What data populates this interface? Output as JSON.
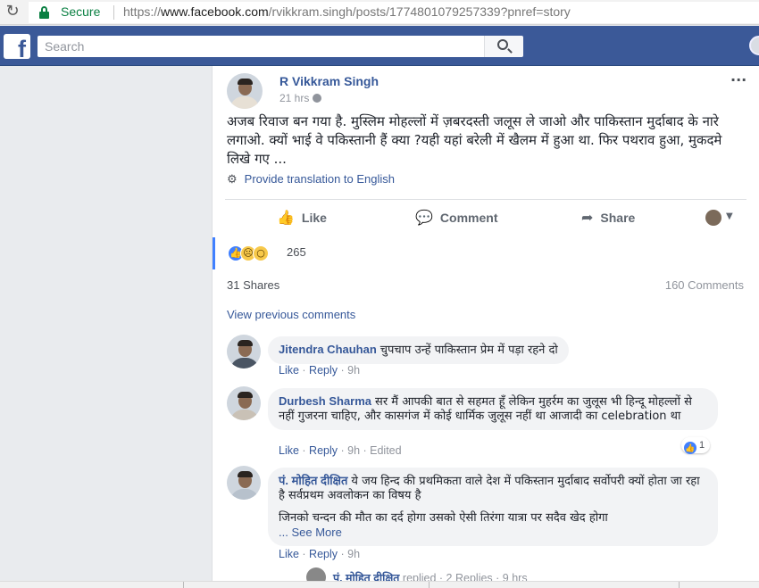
{
  "browser": {
    "security_label": "Secure",
    "url_prefix": "https://",
    "url_domain": "www.facebook.com",
    "url_path": "/rvikkram.singh/posts/1774801079257339?pnref=story"
  },
  "topbar": {
    "logo": "f",
    "search_placeholder": "Search"
  },
  "post": {
    "author": "R Vikkram Singh",
    "time": "21 hrs",
    "text": "अजब रिवाज बन गया है. मुस्लिम मोहल्लों में ज़बरदस्ती जलूस ले जाओ और पाकिस्तान मुर्दाबाद के नारे लगाओ. क्यों भाई वे पकिस्तानी हैं क्या ?यही यहां बरेली में खैलम में हुआ था. फिर पथराव हुआ, मुकदमे लिखे गए ...",
    "translate_label": "Provide translation to English",
    "actions": {
      "like": "Like",
      "comment": "Comment",
      "share": "Share"
    },
    "reaction_count": "265",
    "shares": "31 Shares",
    "comments_count": "160 Comments",
    "view_previous": "View previous comments"
  },
  "comments": [
    {
      "name": "Jitendra Chauhan",
      "text": "चुपचाप उन्हें पाकिस्तान प्रेम में पड़ा रहने दो",
      "like": "Like",
      "reply": "Reply",
      "time": "9h"
    },
    {
      "name": "Durbesh Sharma",
      "text": "सर मैं आपकी बात से सहमत हूँ लेकिन मुहर्रम का जुलूस भी हिन्दू मोहल्लों से नहीं गुजरना चाहिए, और कासगंज में कोई धार्मिक जुलूस नहीं था आजादी का celebration था",
      "like": "Like",
      "reply": "Reply",
      "time": "9h",
      "edited": "Edited",
      "like_count": "1"
    },
    {
      "name": "पं. मोहित दीक्षित",
      "text": "ये जय हिन्द की प्रथमिकता वाले देश में पकिस्तान मुर्दाबाद सर्वोपरी क्यों होता जा रहा है सर्वप्रथम अवलोकन का विषय है",
      "text2": "जिनको चन्दन की मौत का दर्द होगा उसको ऐसी तिरंगा यात्रा पर सदैव खेद होगा",
      "see_more": "... See More",
      "like": "Like",
      "reply": "Reply",
      "time": "9h"
    }
  ],
  "reply_preview": {
    "name": "पं. मोहित दीक्षित",
    "text": "replied · 2 Replies · 9 hrs"
  }
}
